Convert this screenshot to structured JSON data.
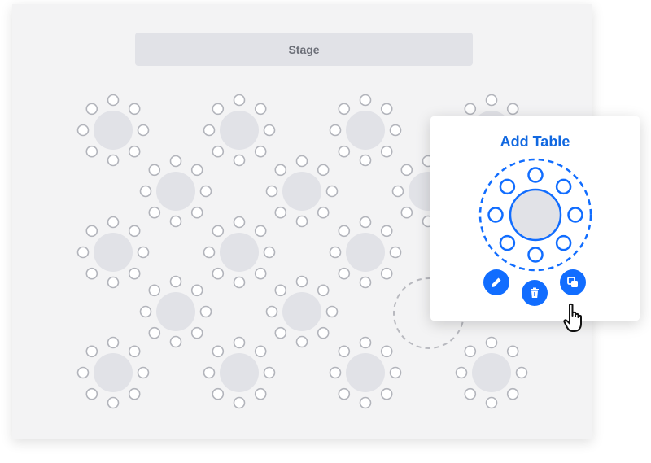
{
  "stage": {
    "label": "Stage"
  },
  "popup": {
    "title": "Add Table",
    "actions": [
      "edit-icon",
      "delete-icon",
      "duplicate-icon"
    ]
  },
  "colors": {
    "accent": "#116dff",
    "table_fill": "#e1e2e7",
    "chair_stroke": "#b2b4bb",
    "placeholder_stroke": "#b8b9bf",
    "background": "#f3f3f4"
  }
}
